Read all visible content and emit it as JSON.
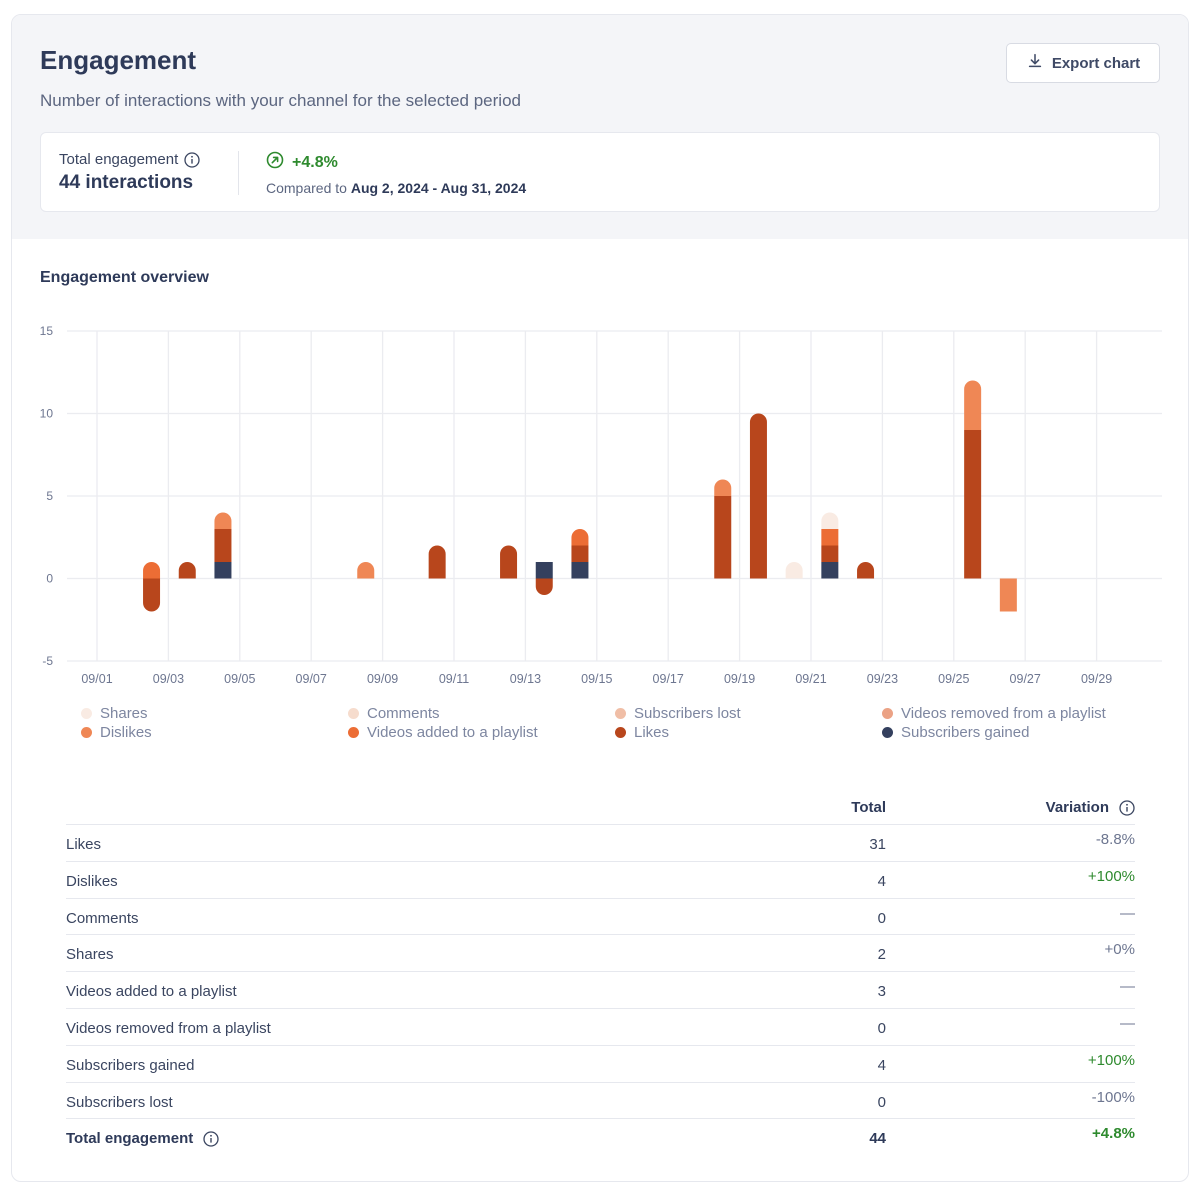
{
  "header": {
    "title": "Engagement",
    "subtitle": "Number of interactions with your channel for the selected period",
    "export_label": "Export chart"
  },
  "summary": {
    "label": "Total engagement",
    "value": "44 interactions",
    "delta": "+4.8%",
    "compare_prefix": "Compared to",
    "compare_range": "Aug 2, 2024 - Aug 31, 2024"
  },
  "section_title": "Engagement overview",
  "colors": {
    "Shares": "#f9ebe3",
    "Comments": "#f6dccd",
    "Subscribers lost": "#f0bea6",
    "Videos removed from a playlist": "#eba285",
    "Dislikes": "#ef8755",
    "Videos added to a playlist": "#ec6d35",
    "Likes": "#b8461c",
    "Subscribers gained": "#34405e",
    "positive": "#2e8a2e"
  },
  "chart_data": {
    "type": "bar",
    "stacked": true,
    "title": "Engagement overview",
    "xlabel": "",
    "ylabel": "",
    "ylim": [
      -5,
      15
    ],
    "yticks": [
      15,
      10,
      5,
      0,
      -5
    ],
    "grid": true,
    "legend_position": "bottom",
    "x": [
      "09/01",
      "09/02",
      "09/03",
      "09/04",
      "09/05",
      "09/06",
      "09/07",
      "09/08",
      "09/09",
      "09/10",
      "09/11",
      "09/12",
      "09/13",
      "09/14",
      "09/15",
      "09/16",
      "09/17",
      "09/18",
      "09/19",
      "09/20",
      "09/21",
      "09/22",
      "09/23",
      "09/24",
      "09/25",
      "09/26",
      "09/27",
      "09/28",
      "09/29",
      "09/30"
    ],
    "xticks": [
      "09/01",
      "09/03",
      "09/05",
      "09/07",
      "09/09",
      "09/11",
      "09/13",
      "09/15",
      "09/17",
      "09/19",
      "09/21",
      "09/23",
      "09/25",
      "09/27",
      "09/29"
    ],
    "series": [
      {
        "name": "Subscribers gained",
        "values": [
          0,
          0,
          0,
          1,
          0,
          0,
          0,
          0,
          0,
          0,
          0,
          0,
          1,
          1,
          0,
          0,
          0,
          0,
          0,
          0,
          1,
          0,
          0,
          0,
          0,
          0,
          0,
          0,
          0,
          0
        ]
      },
      {
        "name": "Likes",
        "values": [
          0,
          -2,
          1,
          2,
          0,
          0,
          0,
          0,
          0,
          2,
          0,
          2,
          -1,
          1,
          0,
          0,
          0,
          5,
          10,
          0,
          1,
          1,
          0,
          0,
          9,
          0,
          0,
          0,
          0,
          0
        ]
      },
      {
        "name": "Videos added to a playlist",
        "values": [
          0,
          1,
          0,
          0,
          0,
          0,
          0,
          0,
          0,
          0,
          0,
          0,
          0,
          1,
          0,
          0,
          0,
          0,
          0,
          0,
          1,
          0,
          0,
          0,
          0,
          0,
          0,
          0,
          0,
          0
        ]
      },
      {
        "name": "Dislikes",
        "values": [
          0,
          0,
          0,
          1,
          0,
          0,
          0,
          1,
          0,
          0,
          0,
          0,
          0,
          0,
          0,
          0,
          0,
          1,
          0,
          0,
          0,
          0,
          0,
          0,
          3,
          -2,
          0,
          0,
          0,
          0
        ]
      },
      {
        "name": "Videos removed from a playlist",
        "values": [
          0,
          0,
          0,
          0,
          0,
          0,
          0,
          0,
          0,
          0,
          0,
          0,
          0,
          0,
          0,
          0,
          0,
          0,
          0,
          0,
          0,
          0,
          0,
          0,
          0,
          0,
          0,
          0,
          0,
          0
        ]
      },
      {
        "name": "Subscribers lost",
        "values": [
          0,
          0,
          0,
          0,
          0,
          0,
          0,
          0,
          0,
          0,
          0,
          0,
          0,
          0,
          0,
          0,
          0,
          0,
          0,
          0,
          0,
          0,
          0,
          0,
          0,
          0,
          0,
          0,
          0,
          0
        ]
      },
      {
        "name": "Comments",
        "values": [
          0,
          0,
          0,
          0,
          0,
          0,
          0,
          0,
          0,
          0,
          0,
          0,
          0,
          0,
          0,
          0,
          0,
          0,
          0,
          0,
          0,
          0,
          0,
          0,
          0,
          0,
          0,
          0,
          0,
          0
        ]
      },
      {
        "name": "Shares",
        "values": [
          0,
          0,
          0,
          0,
          0,
          0,
          0,
          0,
          0,
          0,
          0,
          0,
          0,
          0,
          0,
          0,
          0,
          0,
          0,
          1,
          1,
          0,
          0,
          0,
          0,
          0,
          0,
          0,
          0,
          0
        ]
      }
    ],
    "legend": [
      "Shares",
      "Comments",
      "Subscribers lost",
      "Videos removed from a playlist",
      "Dislikes",
      "Videos added to a playlist",
      "Likes",
      "Subscribers gained"
    ]
  },
  "table": {
    "headers": {
      "total": "Total",
      "variation": "Variation"
    },
    "rows": [
      {
        "name": "Likes",
        "total": "31",
        "variation": "-8.8%",
        "positive": false
      },
      {
        "name": "Dislikes",
        "total": "4",
        "variation": "+100%",
        "positive": true
      },
      {
        "name": "Comments",
        "total": "0",
        "variation": "—",
        "positive": false
      },
      {
        "name": "Shares",
        "total": "2",
        "variation": "+0%",
        "positive": false
      },
      {
        "name": "Videos added to a playlist",
        "total": "3",
        "variation": "—",
        "positive": false
      },
      {
        "name": "Videos removed from a playlist",
        "total": "0",
        "variation": "—",
        "positive": false
      },
      {
        "name": "Subscribers gained",
        "total": "4",
        "variation": "+100%",
        "positive": true
      },
      {
        "name": "Subscribers lost",
        "total": "0",
        "variation": "-100%",
        "positive": false
      }
    ],
    "total_row": {
      "name": "Total engagement",
      "total": "44",
      "variation": "+4.8%",
      "positive": true
    }
  }
}
